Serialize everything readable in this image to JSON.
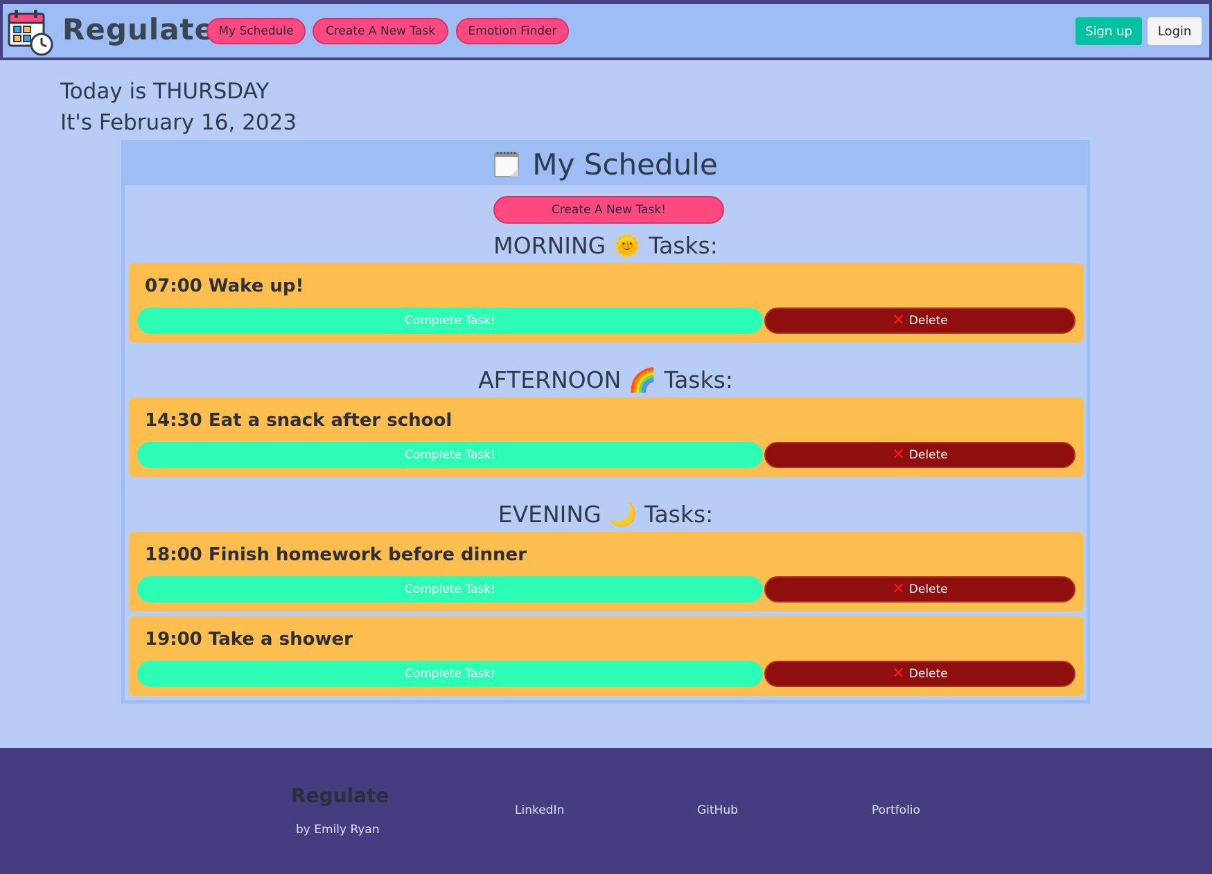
{
  "navbar": {
    "brand": "Regulate",
    "links": [
      "My Schedule",
      "Create A New Task",
      "Emotion Finder"
    ],
    "signup_label": "Sign up",
    "login_label": "Login"
  },
  "today": {
    "day_line": "Today is THURSDAY",
    "date_line": "It's February 16, 2023"
  },
  "schedule": {
    "title": "My Schedule",
    "create_label": "Create A New Task!",
    "sections": [
      {
        "title": "MORNING 🌞 Tasks:",
        "tasks": [
          {
            "title": "07:00 Wake up!"
          }
        ]
      },
      {
        "title": "AFTERNOON 🌈 Tasks:",
        "tasks": [
          {
            "title": "14:30 Eat a snack after school"
          }
        ]
      },
      {
        "title": "EVENING 🌙 Tasks:",
        "tasks": [
          {
            "title": "18:00 Finish homework before dinner"
          },
          {
            "title": "19:00 Take a shower"
          }
        ]
      }
    ],
    "complete_label": "Complete Task!",
    "delete_label": "Delete"
  },
  "footer": {
    "brand": "Regulate",
    "byline": "by Emily Ryan",
    "links": [
      "LinkedIn",
      "GitHub",
      "Portfolio"
    ]
  },
  "colors": {
    "page_bg": "#b8cdf5",
    "nav_bg": "#9dbdf4",
    "accent_pink": "#fc4a80",
    "task_card": "#fdbe50",
    "complete_green": "#2dfdb5",
    "delete_red": "#8f0f0f",
    "footer_bg": "#463d80",
    "signup_teal": "#03c1a1"
  },
  "icons": {
    "logo": "calendar-clock-icon",
    "schedule": "notepad-icon",
    "delete": "cross-mark-icon"
  }
}
